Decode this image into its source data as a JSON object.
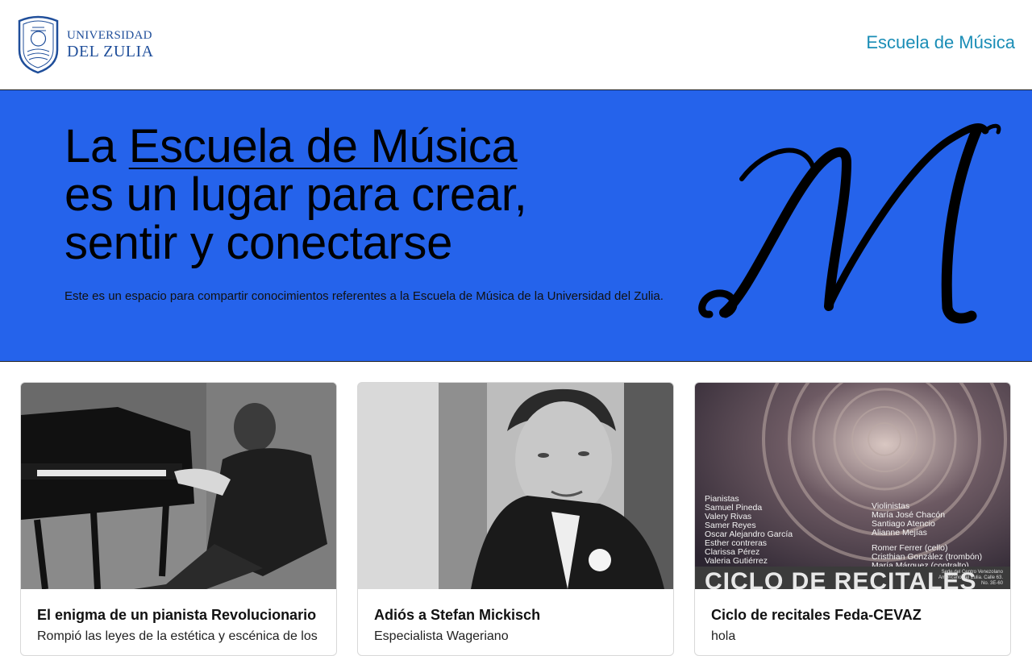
{
  "header": {
    "logo_line1": "UNIVERSIDAD",
    "logo_line2": "DEL ZULIA",
    "nav_link": "Escuela de Música"
  },
  "hero": {
    "title_prefix": "La ",
    "title_link": "Escuela de Música",
    "title_line2": "es un lugar para crear,",
    "title_line3": "sentir y conectarse",
    "description": "Este es un espacio para compartir conocimientos referentes a la Escuela de Música de la Universidad del Zulia.",
    "mark_letter": "M"
  },
  "cards": [
    {
      "title": "El enigma de un pianista Revolucionario",
      "text": "Rompió las leyes de la estética y escénica de los"
    },
    {
      "title": "Adiós a Stefan Mickisch",
      "text": "Especialista Wageriano"
    },
    {
      "title": "Ciclo de recitales Feda-CEVAZ",
      "text": "hola"
    }
  ],
  "poster": {
    "left_heading": "Pianistas",
    "left_names": [
      "Samuel Pineda",
      "Valery Rivas",
      "Samer Reyes",
      "Oscar Alejandro García",
      "Esther contreras",
      "Clarissa Pérez",
      "Valeria Gutiérrez"
    ],
    "right_heading": "Violinistas",
    "right_names": [
      "María José Chacón",
      "Santiago Atencio",
      "Alianne Mejías"
    ],
    "right_names2": [
      "Romer Ferrer (cello)",
      "Cristhian González (trombón)",
      "María Márquez (contralto)"
    ],
    "banner": "CICLO DE RECITALES",
    "venue": "Sede del Centro Venezolano Americano del Zulia. Calle 63. No. 3E-60"
  },
  "colors": {
    "hero_bg": "#2563eb",
    "nav_link": "#1a8db6",
    "logo": "#1f4e9a"
  }
}
